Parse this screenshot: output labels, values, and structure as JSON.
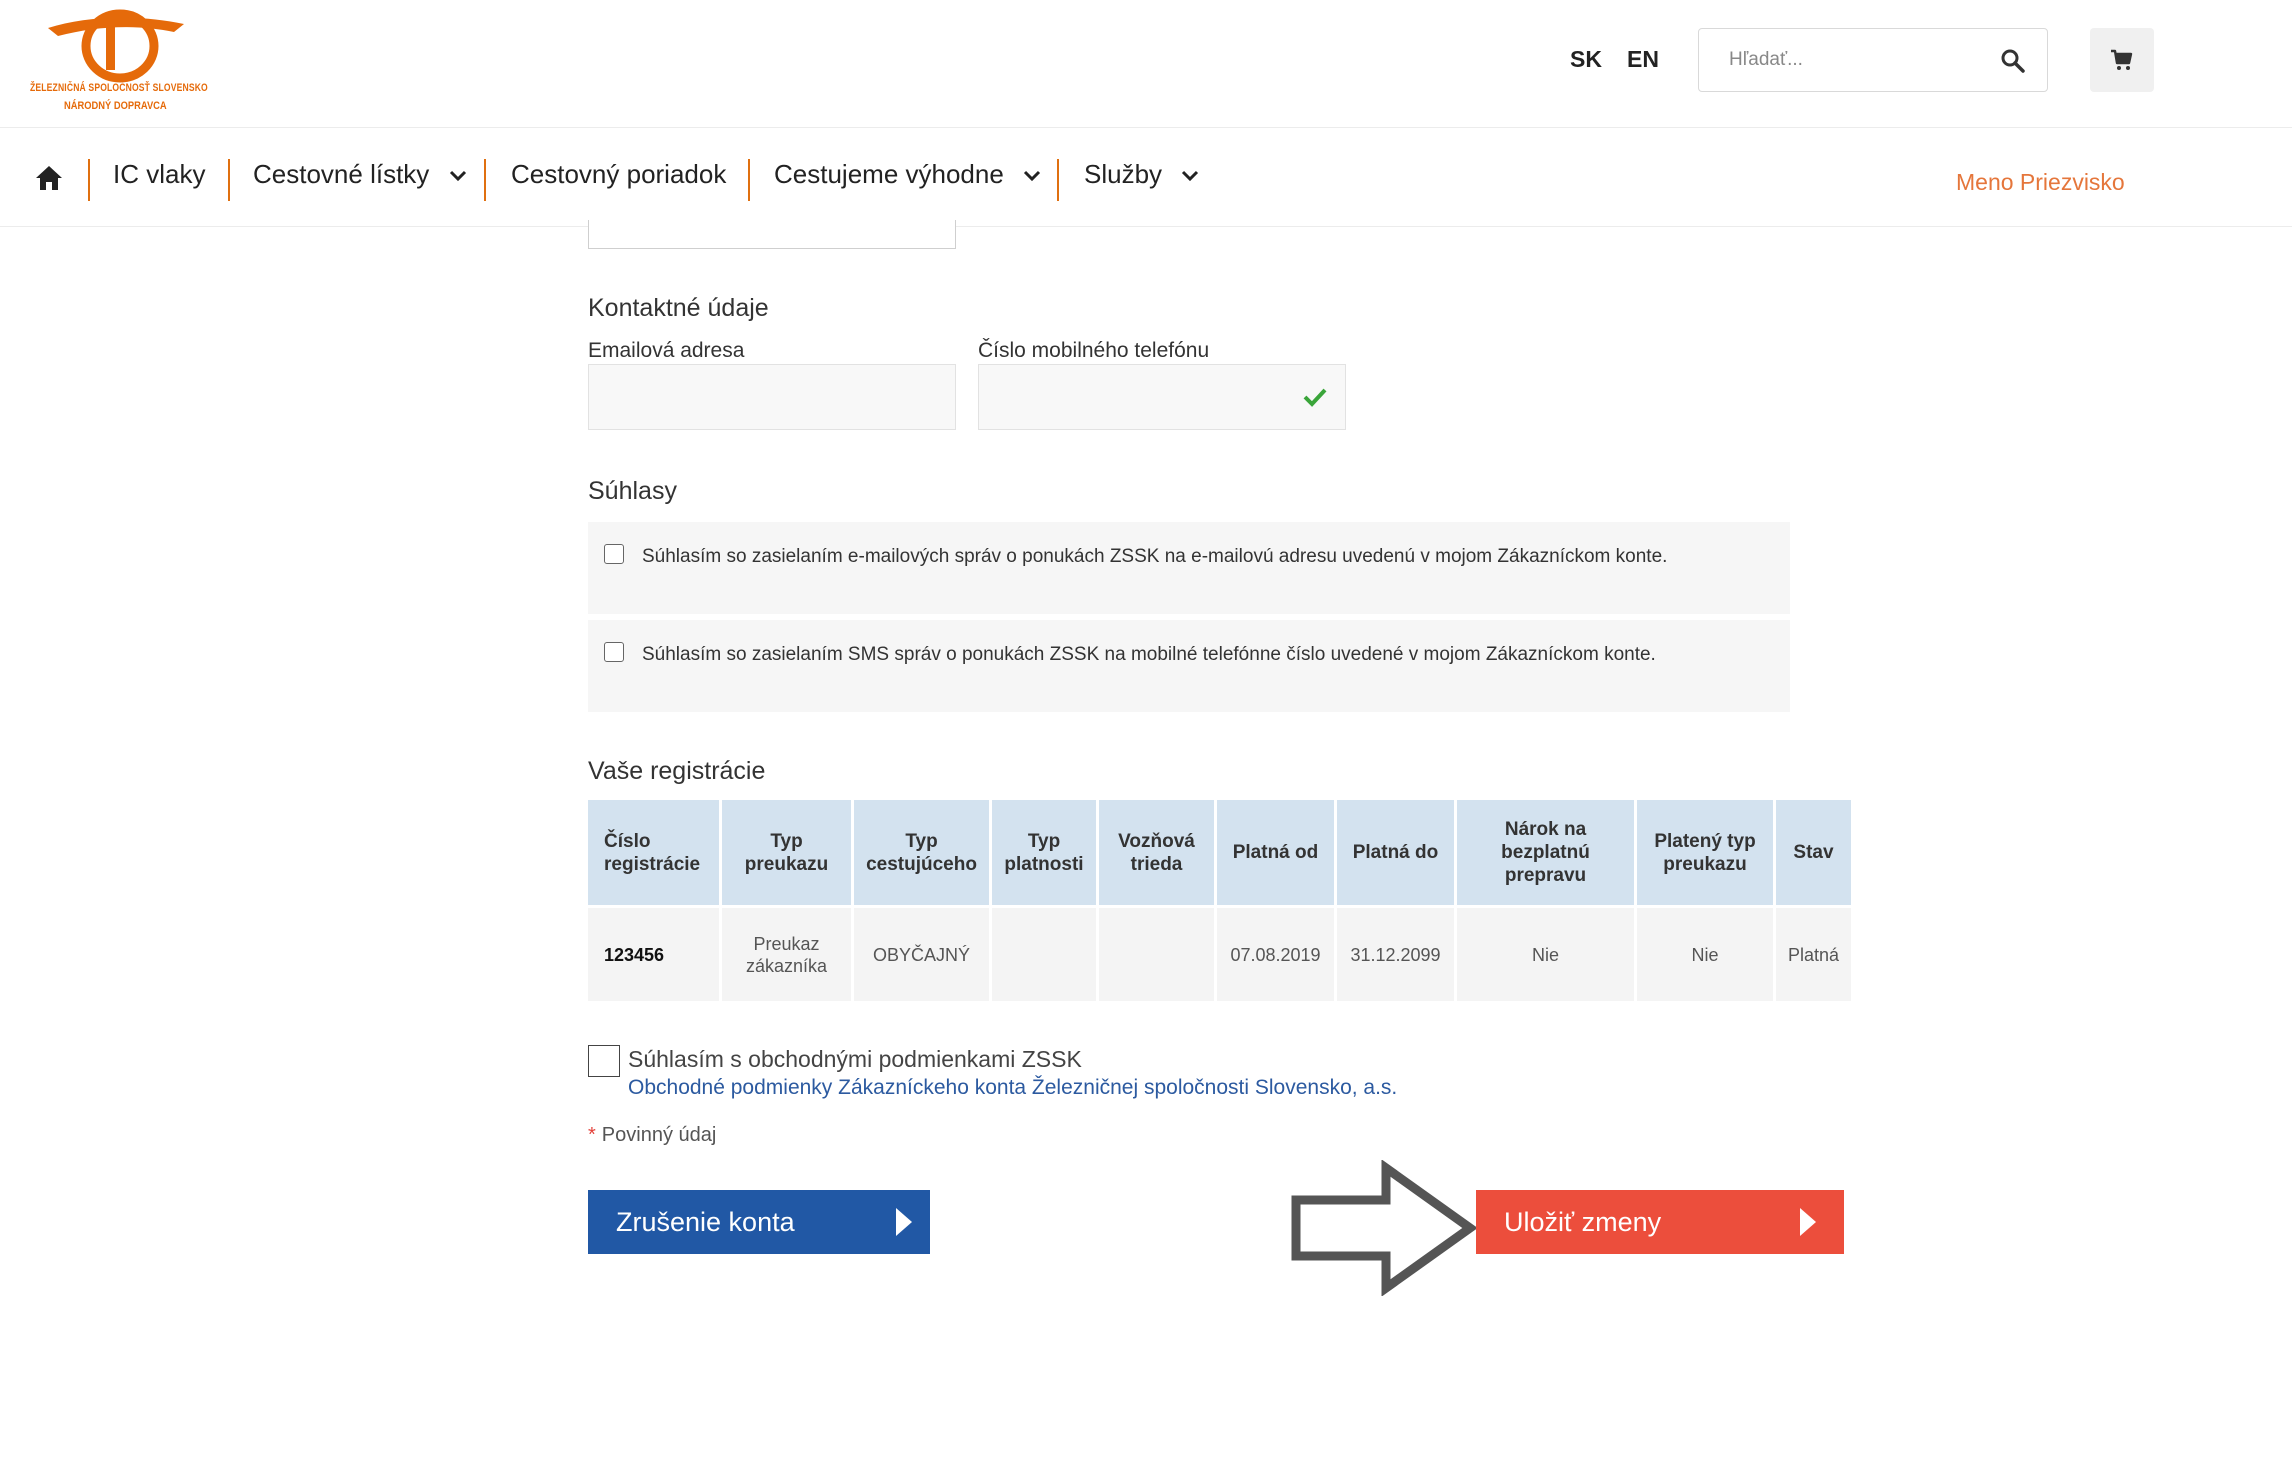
{
  "header": {
    "logo_line1": "ŽELEZNIČNÁ SPOLOČNOSŤ SLOVENSKO",
    "logo_line2": "NÁRODNÝ DOPRAVCA",
    "lang_sk": "SK",
    "lang_en": "EN",
    "search_placeholder": "Hľadať...",
    "icons": {
      "search": "search-icon",
      "cart": "cart-icon"
    }
  },
  "nav": {
    "home_icon": "home-icon",
    "items": [
      {
        "label": "IC vlaky"
      },
      {
        "label": "Cestovné lístky"
      },
      {
        "label": "Cestovný poriadok"
      },
      {
        "label": "Cestujeme výhodne"
      },
      {
        "label": "Služby"
      }
    ],
    "user": "Meno Priezvisko"
  },
  "contact": {
    "title": "Kontaktné údaje",
    "email_label": "Emailová adresa",
    "email_value": "",
    "phone_label": "Číslo mobilného telefónu",
    "phone_value": ""
  },
  "consents": {
    "title": "Súhlasy",
    "items": [
      {
        "text": "Súhlasím so zasielaním e-mailových správ o ponukách ZSSK na e-mailovú adresu uvedenú v mojom Zákazníckom konte."
      },
      {
        "text": "Súhlasím so zasielaním SMS správ o ponukách ZSSK na mobilné telefónne číslo uvedené v mojom Zákazníckom konte."
      }
    ]
  },
  "registrations": {
    "title": "Vaše registrácie",
    "columns": [
      "Číslo registrácie",
      "Typ preukazu",
      "Typ cestujúceho",
      "Typ platnosti",
      "Vozňová trieda",
      "Platná od",
      "Platná do",
      "Nárok na bezplatnú prepravu",
      "Platený typ preukazu",
      "Stav"
    ],
    "rows": [
      [
        "123456",
        "Preukaz zákazníka",
        "OBYČAJNÝ",
        "",
        "",
        "07.08.2019",
        "31.12.2099",
        "Nie",
        "Nie",
        "Platná"
      ]
    ]
  },
  "terms": {
    "label": "Súhlasím s obchodnými podmienkami ZSSK",
    "link": "Obchodné podmienky Zákazníckeho konta Železničnej spoločnosti Slovensko, a.s."
  },
  "required_note": "Povinný údaj",
  "buttons": {
    "cancel": "Zrušenie konta",
    "save": "Uložiť zmeny"
  },
  "colors": {
    "brand_orange": "#e56a0a",
    "link_blue": "#2c5aa0",
    "cancel_blue": "#2158a5",
    "save_red": "#ec4e3c",
    "table_header": "#d3e2ef"
  }
}
